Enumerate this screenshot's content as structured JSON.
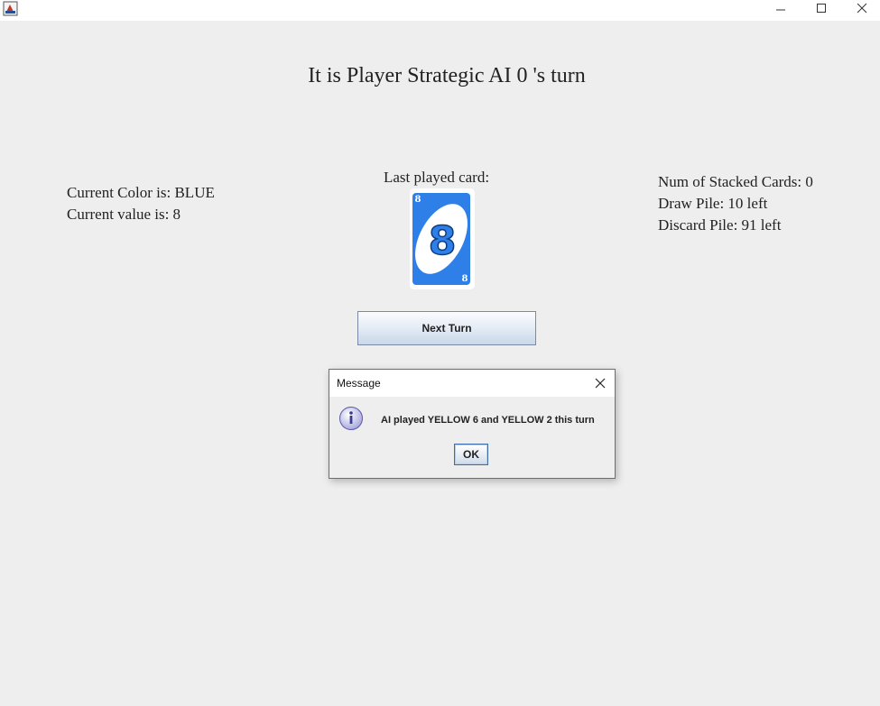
{
  "window": {
    "app_icon": "java-app-icon",
    "controls": [
      "minimize-icon",
      "maximize-icon",
      "close-icon"
    ]
  },
  "game": {
    "turn_title": "It is Player Strategic AI 0 's turn",
    "current_color": "Current Color is: BLUE",
    "current_value": "Current value is: 8",
    "last_played_label": "Last played card:",
    "last_card": {
      "value": "8",
      "color": "#2e7fe8"
    },
    "stacked_cards": "Num of Stacked Cards: 0",
    "draw_pile": "Draw Pile: 10 left",
    "discard_pile": "Discard Pile: 91 left",
    "next_turn_label": "Next Turn"
  },
  "dialog": {
    "title": "Message",
    "icon": "info-icon",
    "message": "AI played YELLOW 6 and YELLOW 2 this turn",
    "ok_label": "OK"
  }
}
